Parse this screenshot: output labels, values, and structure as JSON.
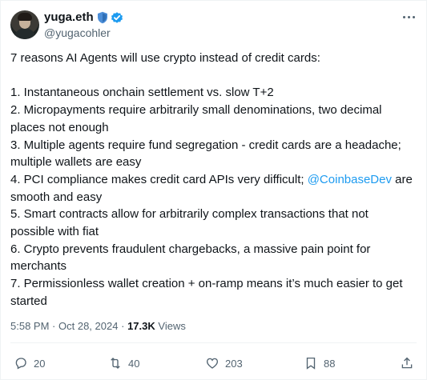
{
  "author": {
    "display_name": "yuga.eth",
    "handle": "@yugacohler",
    "badges": [
      "shield-icon",
      "verified-icon"
    ]
  },
  "tweet": {
    "intro": "7 reasons AI Agents will use crypto instead of credit cards:",
    "line1": "1. Instantaneous onchain settlement vs. slow T+2",
    "line2": "2. Micropayments require arbitrarily small denominations, two decimal places not enough",
    "line3": "3. Multiple agents require fund segregation - credit cards are a headache; multiple wallets are easy",
    "line4_before": "4. PCI compliance makes credit card APIs very difficult; ",
    "line4_mention": "@CoinbaseDev",
    "line4_after": " are smooth and easy",
    "line5": "5. Smart contracts allow for arbitrarily complex transactions that not possible with fiat",
    "line6": "6. Crypto prevents fraudulent chargebacks, a massive pain point for merchants",
    "line7": "7. Permissionless wallet creation + on-ramp means it’s much easier to get started"
  },
  "meta": {
    "time": "5:58 PM",
    "separator": "·",
    "date": "Oct 28, 2024",
    "views_count": "17.3K",
    "views_label": "Views"
  },
  "actions": {
    "replies": "20",
    "reposts": "40",
    "likes": "203",
    "bookmarks": "88"
  },
  "colors": {
    "text": "#0f1419",
    "secondary": "#536471",
    "link": "#1d9bf0",
    "verified": "#1d9bf0",
    "shield": "#4c8ed8",
    "divider": "#eff3f4"
  }
}
